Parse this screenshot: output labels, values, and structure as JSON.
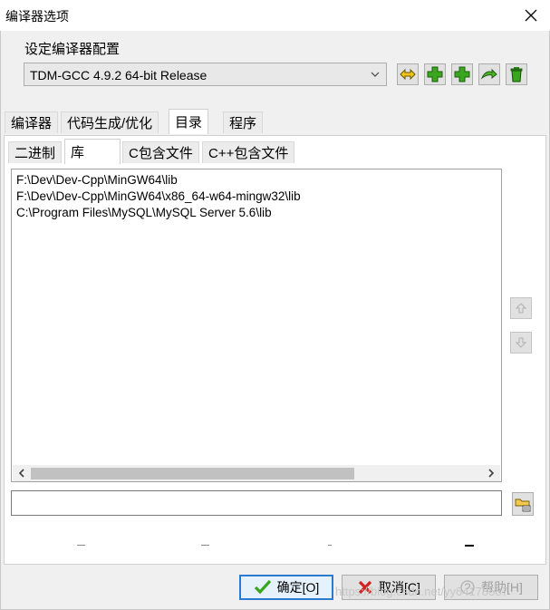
{
  "window": {
    "title": "编译器选项"
  },
  "config": {
    "group_label": "设定编译器配置",
    "selected": "TDM-GCC 4.9.2 64-bit Release"
  },
  "main_tabs": [
    {
      "label": "编译器"
    },
    {
      "label": "代码生成/优化"
    },
    {
      "label": "目录"
    },
    {
      "label": "程序"
    }
  ],
  "sub_tabs": [
    {
      "label": "二进制"
    },
    {
      "label": "库"
    },
    {
      "label": "C包含文件"
    },
    {
      "label": "C++包含文件"
    }
  ],
  "lib_paths": [
    "F:\\Dev\\Dev-Cpp\\MinGW64\\lib",
    "F:\\Dev\\Dev-Cpp\\MinGW64\\x86_64-w64-mingw32\\lib",
    "C:\\Program Files\\MySQL\\MySQL Server 5.6\\lib"
  ],
  "path_input": {
    "value": ""
  },
  "buttons": {
    "ok": "确定[O]",
    "cancel": "取消[C]",
    "help": "帮助[H]"
  },
  "watermark": "https://blog.csdn.net/yy64178587",
  "colors": {
    "accent": "#2b7bd0",
    "green": "#3aa51f",
    "red_x": "#d32020"
  }
}
